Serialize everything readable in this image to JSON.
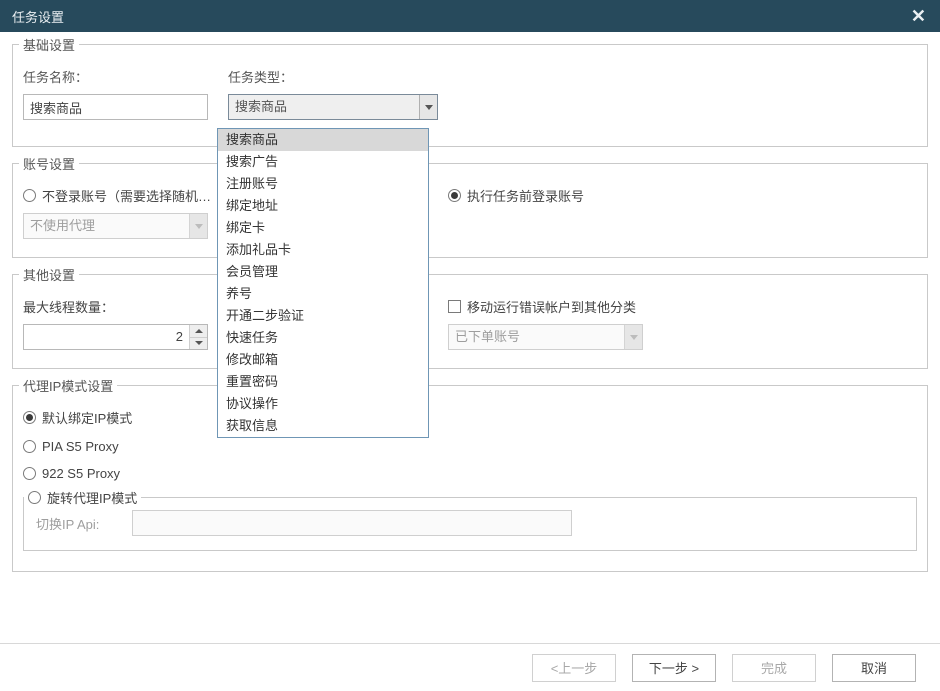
{
  "window": {
    "title": "任务设置",
    "close_glyph": "✕"
  },
  "basic": {
    "legend": "基础设置",
    "task_name_label": "任务名称：",
    "task_name_value": "搜索商品",
    "task_type_label": "任务类型：",
    "task_type_value": "搜索商品",
    "task_type_options": [
      "搜索商品",
      "搜索广告",
      "注册账号",
      "绑定地址",
      "绑定卡",
      "添加礼品卡",
      "会员管理",
      "养号",
      "开通二步验证",
      "快速任务",
      "修改邮箱",
      "重置密码",
      "协议操作",
      "获取信息"
    ],
    "task_type_highlight_index": 0
  },
  "account": {
    "legend": "账号设置",
    "radio_no_login_label": "不登录账号（需要选择随机…",
    "radio_login_first_label": "执行任务前登录账号",
    "selected": "login_first",
    "proxy_select_value": "不使用代理"
  },
  "other": {
    "legend": "其他设置",
    "max_threads_label": "最大线程数量：",
    "max_threads_value": "2",
    "move_error_account_label": "移动运行错误帐户到其他分类",
    "move_error_account_checked": false,
    "category_select_value": "已下单账号"
  },
  "ip_mode": {
    "legend": "代理IP模式设置",
    "radio_default_label": "默认绑定IP模式",
    "radio_pia_label": "PIA S5 Proxy",
    "radio_922_label": "922 S5 Proxy",
    "radio_rotating_label": "旋转代理IP模式",
    "selected": "default",
    "rotating_api_label": "切换IP Api:",
    "rotating_api_value": ""
  },
  "footer": {
    "prev": "<上一步",
    "next": "下一步 >",
    "finish": "完成",
    "cancel": "取消"
  }
}
